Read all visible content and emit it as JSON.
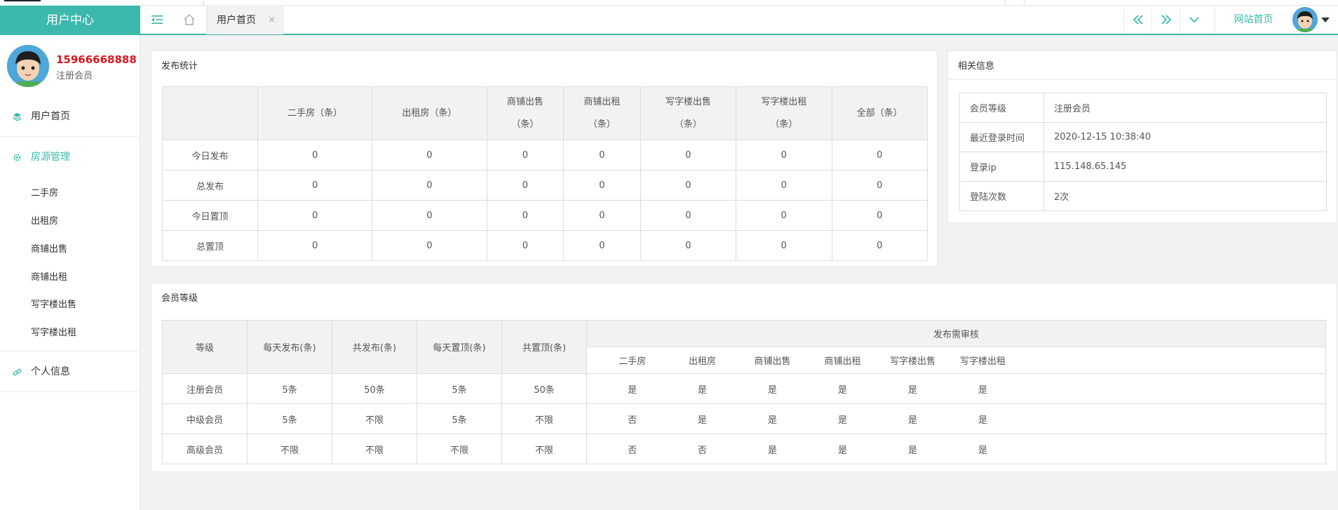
{
  "app": {
    "brand": "用户中心",
    "tab_label": "用户首页",
    "tab_close": "×",
    "site_link": "网站首页"
  },
  "user": {
    "phone": "15966668888",
    "role": "注册会员"
  },
  "sidebar": {
    "home": "用户首页",
    "house_mgmt": "房源管理",
    "sub_items": [
      "二手房",
      "出租房",
      "商铺出售",
      "商铺出租",
      "写字楼出售",
      "写字楼出租"
    ],
    "profile": "个人信息"
  },
  "stats": {
    "title": "发布统计",
    "headers": [
      "二手房（条）",
      "出租房（条）",
      "商铺出售",
      "商铺出租",
      "写字楼出售",
      "写字楼出租",
      "全部（条）"
    ],
    "header_suffix": "（条）",
    "rows": [
      {
        "label": "今日发布",
        "values": [
          "0",
          "0",
          "0",
          "0",
          "0",
          "0",
          "0"
        ]
      },
      {
        "label": "总发布",
        "values": [
          "0",
          "0",
          "0",
          "0",
          "0",
          "0",
          "0"
        ]
      },
      {
        "label": "今日置顶",
        "values": [
          "0",
          "0",
          "0",
          "0",
          "0",
          "0",
          "0"
        ]
      },
      {
        "label": "总置顶",
        "values": [
          "0",
          "0",
          "0",
          "0",
          "0",
          "0",
          "0"
        ]
      }
    ]
  },
  "info": {
    "title": "相关信息",
    "rows": [
      {
        "key": "会员等级",
        "value": "注册会员"
      },
      {
        "key": "最近登录时间",
        "value": "2020-12-15 10:38:40"
      },
      {
        "key": "登录ip",
        "value": "115.148.65.145"
      },
      {
        "key": "登陆次数",
        "value": "2次"
      }
    ]
  },
  "levels": {
    "title": "会员等级",
    "headers": [
      "等级",
      "每天发布(条)",
      "共发布(条)",
      "每天置顶(条)",
      "共置顶(条)"
    ],
    "review_header": "发布需审核",
    "review_sub": [
      "二手房",
      "出租房",
      "商铺出售",
      "商铺出租",
      "写字楼出售",
      "写字楼出租"
    ],
    "rows": [
      {
        "cells": [
          "注册会员",
          "5条",
          "50条",
          "5条",
          "50条"
        ],
        "review": [
          "是",
          "是",
          "是",
          "是",
          "是",
          "是"
        ]
      },
      {
        "cells": [
          "中级会员",
          "5条",
          "不限",
          "5条",
          "不限"
        ],
        "review": [
          "否",
          "是",
          "是",
          "是",
          "是",
          "是"
        ]
      },
      {
        "cells": [
          "高级会员",
          "不限",
          "不限",
          "不限",
          "不限"
        ],
        "review": [
          "否",
          "否",
          "是",
          "是",
          "是",
          "是"
        ]
      }
    ]
  },
  "colors": {
    "accent": "#3cb8ad",
    "phone": "#d71920"
  }
}
